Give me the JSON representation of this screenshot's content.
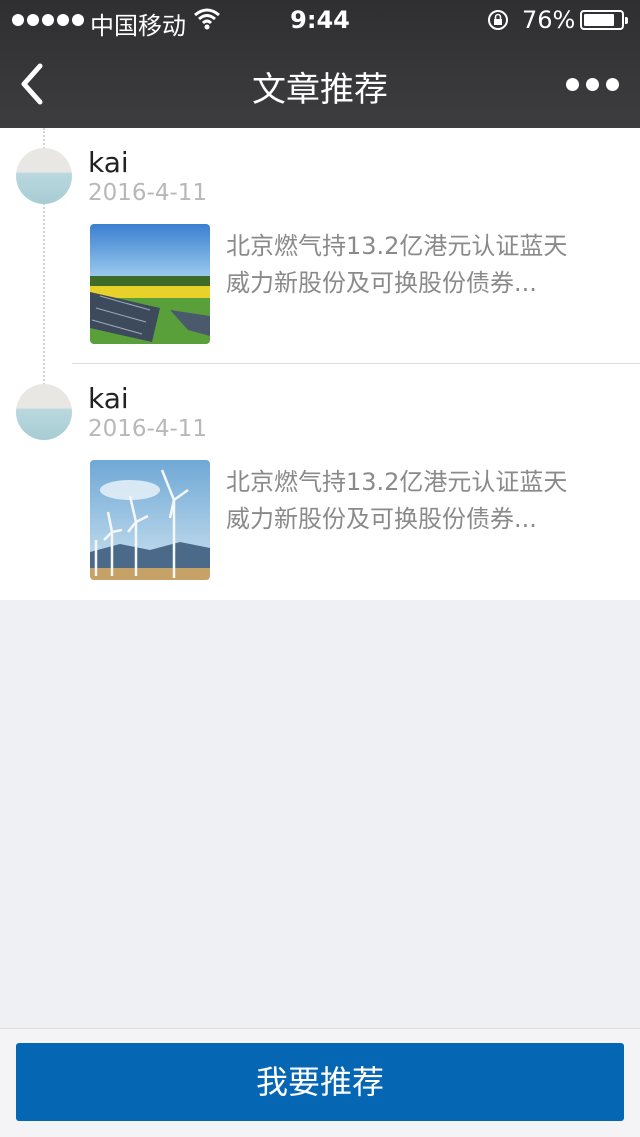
{
  "status_bar": {
    "carrier": "中国移动",
    "time": "9:44",
    "battery": "76%",
    "battery_level": 0.76,
    "signal_bars": 5
  },
  "nav": {
    "title": "文章推荐",
    "back_icon": "chevron-left-icon",
    "more_icon": "more-dots-icon"
  },
  "articles": [
    {
      "author": "kai",
      "date": "2016-4-11",
      "summary_line1": "北京燃气持13.2亿港元认证蓝天",
      "summary_line2": "威力新股份及可换股份债券...",
      "thumbnail": "solar-panels-image"
    },
    {
      "author": "kai",
      "date": "2016-4-11",
      "summary_line1": "北京燃气持13.2亿港元认证蓝天",
      "summary_line2": "威力新股份及可换股份债券...",
      "thumbnail": "wind-turbines-image"
    }
  ],
  "footer": {
    "button_label": "我要推荐"
  },
  "colors": {
    "header_bg": "#333335",
    "accent": "#0566b4",
    "page_bg": "#eff0f4"
  }
}
